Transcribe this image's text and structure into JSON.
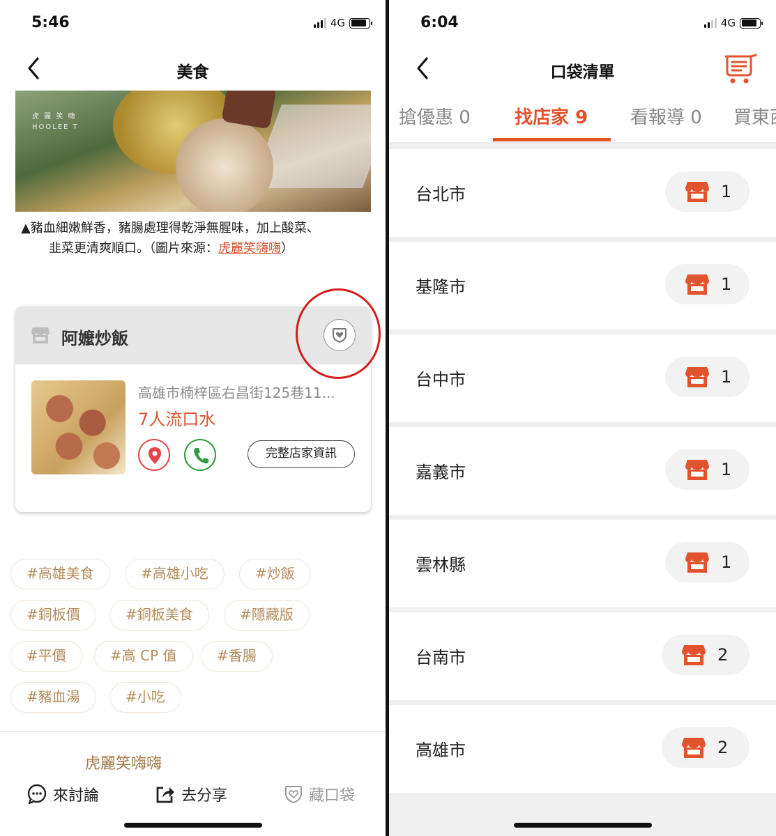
{
  "left": {
    "status": {
      "time": "5:46",
      "network": "4G"
    },
    "nav": {
      "title": "美食"
    },
    "photo": {
      "watermark_line1": "虎 麗 笑 嗨",
      "watermark_line2": "HOOLEE T"
    },
    "caption": {
      "line1": "▲豬血細嫩鮮香，豬腸處理得乾淨無腥味，加上酸菜、",
      "line2_text": "韭菜更清爽順口。（圖片來源：",
      "link": "虎麗笑嗨嗨",
      "line2_end": "）"
    },
    "store": {
      "name": "阿嬤炒飯",
      "address": "高雄市楠梓區右昌街125巷11...",
      "drool": "7人流口水",
      "full_info_button": "完整店家資訊"
    },
    "tags": [
      "#高雄美食",
      "#高雄小吃",
      "#炒飯",
      "#銅板價",
      "#銅板美食",
      "#隱藏版",
      "#平價",
      "#高 CP 值",
      "#香腸",
      "#豬血湯",
      "#小吃"
    ],
    "author": "虎麗笑嗨嗨",
    "bottom_bar": {
      "discuss": "來討論",
      "share": "去分享",
      "save": "藏口袋"
    }
  },
  "right": {
    "status": {
      "time": "6:04",
      "network": "4G"
    },
    "nav": {
      "title": "口袋清單"
    },
    "tabs": [
      {
        "label": "搶優惠 0"
      },
      {
        "label": "找店家 9"
      },
      {
        "label": "看報導 0"
      },
      {
        "label": "買東西"
      }
    ],
    "active_tab": "找店家 9",
    "cities": [
      {
        "name": "台北市",
        "count": "1"
      },
      {
        "name": "基隆市",
        "count": "1"
      },
      {
        "name": "台中市",
        "count": "1"
      },
      {
        "name": "嘉義市",
        "count": "1"
      },
      {
        "name": "雲林縣",
        "count": "1"
      },
      {
        "name": "台南市",
        "count": "2"
      },
      {
        "name": "高雄市",
        "count": "2"
      }
    ]
  },
  "colors": {
    "accent": "#e0532d",
    "tag_text": "#b48c5a",
    "highlight_circle": "#d61c1c",
    "call_green": "#2f9a3e",
    "pin_red": "#e2474a"
  }
}
